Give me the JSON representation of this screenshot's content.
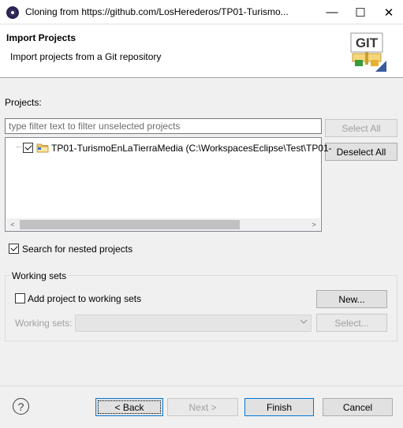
{
  "window": {
    "title": "Cloning from https://github.com/LosHerederos/TP01-Turismo...",
    "minimize_glyph": "—",
    "maximize_glyph": "☐",
    "close_glyph": "✕"
  },
  "header": {
    "title": "Import Projects",
    "description": "Import projects from a Git repository",
    "logo_text": "GIT"
  },
  "projects": {
    "label": "Projects:",
    "filter_placeholder": "type filter text to filter unselected projects",
    "filter_value": "",
    "items": [
      {
        "label": "TP01-TurismoEnLaTierraMedia (C:\\WorkspacesEclipse\\Test\\TP01-",
        "checked": true,
        "icon": "folder-icon"
      }
    ],
    "select_all": "Select All",
    "deselect_all": "Deselect All",
    "scroll_left": "<",
    "scroll_right": ">"
  },
  "options": {
    "search_nested": "Search for nested projects",
    "search_nested_checked": true
  },
  "working_sets": {
    "legend": "Working sets",
    "add_to_working_sets": "Add project to working sets",
    "add_checked": false,
    "new_button": "New...",
    "working_sets_label": "Working sets:",
    "selected_value": "",
    "select_button": "Select..."
  },
  "footer": {
    "help": "?",
    "back": "< Back",
    "next": "Next >",
    "finish": "Finish",
    "cancel": "Cancel"
  },
  "colors": {
    "accent": "#0078d7",
    "window_bg": "#f0f0f0",
    "title_icon": "#2c2255"
  }
}
